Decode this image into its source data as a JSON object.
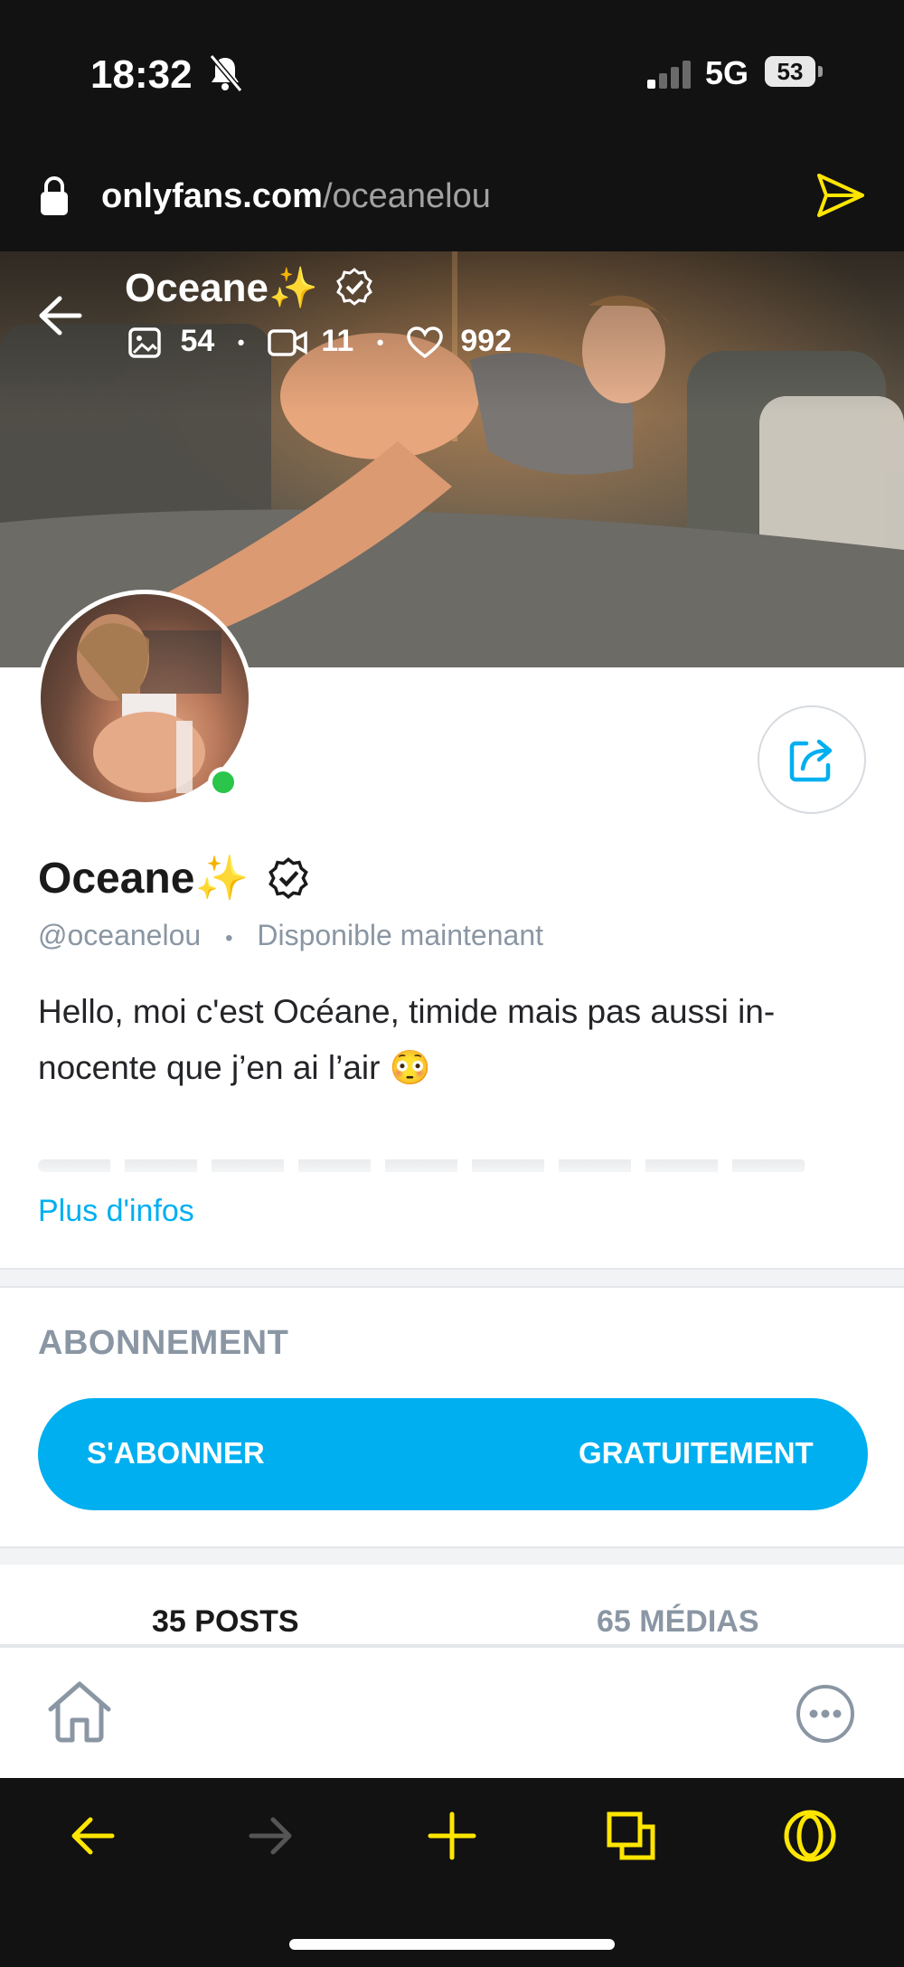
{
  "status": {
    "time": "18:32",
    "network": "5G",
    "battery": "53"
  },
  "browser": {
    "domain": "onlyfans.com",
    "path": "/oceanelou"
  },
  "cover": {
    "name": "Oceane✨",
    "photos_count": "54",
    "videos_count": "11",
    "likes_count": "992",
    "separator": "•"
  },
  "profile": {
    "name": "Oceane✨",
    "handle": "@oceanelou",
    "separator": "•",
    "availability": "Disponible maintenant",
    "bio": "Hello, moi c'est Océane, timide mais pas aussi in-nocente que j’en ai l’air 😳",
    "more_label": "Plus d'infos"
  },
  "subscription": {
    "title": "ABONNEMENT",
    "button_left": "S'ABONNER",
    "button_right": "GRATUITEMENT"
  },
  "tabs": [
    {
      "label": "35 POSTS",
      "active": true
    },
    {
      "label": "65 MÉDIAS",
      "active": false
    }
  ],
  "colors": {
    "accent": "#00aff0",
    "online": "#2ac54a",
    "browser_accent": "#ffe600"
  },
  "icons": {
    "status": [
      "bell-muted-icon",
      "signal-icon",
      "battery-icon"
    ],
    "browser": [
      "lock-icon",
      "send-icon",
      "back-arrow-icon",
      "forward-arrow-icon",
      "plus-icon",
      "tabs-icon",
      "opera-icon"
    ],
    "app": [
      "back-icon",
      "photo-icon",
      "video-icon",
      "heart-icon",
      "verified-icon",
      "share-icon",
      "home-icon",
      "more-icon"
    ]
  }
}
